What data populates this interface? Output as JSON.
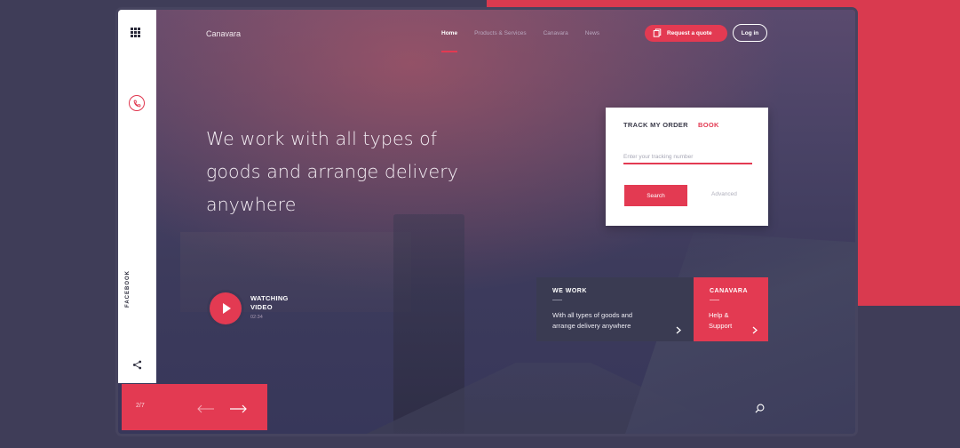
{
  "header": {
    "brand": "Canavara",
    "nav": [
      "Home",
      "Products & Services",
      "Canavara",
      "News"
    ],
    "active_nav": "Home",
    "quote_label": "Request a quote",
    "login_label": "Log in"
  },
  "sidebar": {
    "social_label": "FACEBOOK",
    "icons": [
      "grid-menu-icon",
      "phone-icon",
      "share-icon"
    ]
  },
  "hero": {
    "headline_lines": [
      "We work with all types of",
      "goods and arrange delivery",
      "anywhere"
    ]
  },
  "video": {
    "title_line1": "WATCHING",
    "title_line2": "VIDEO",
    "duration": "02:34"
  },
  "tracking": {
    "tab_track": "TRACK MY ORDER",
    "tab_book": "BOOK",
    "input_placeholder": "Enter your tracking number",
    "input_value": "",
    "search_label": "Search",
    "advanced_label": "Advanced"
  },
  "cards": {
    "work": {
      "title": "WE WORK",
      "text_line1": "With all types of goods and",
      "text_line2": "arrange delivery anywhere"
    },
    "canavara": {
      "title": "CANAVARA",
      "text_line1": "Help &",
      "text_line2": "Support"
    }
  },
  "pager": {
    "count": "2/7"
  },
  "colors": {
    "accent": "#e33a52",
    "background": "#3f3d58",
    "card_dark": "#3a3b52",
    "sidebar": "#ffffff"
  }
}
